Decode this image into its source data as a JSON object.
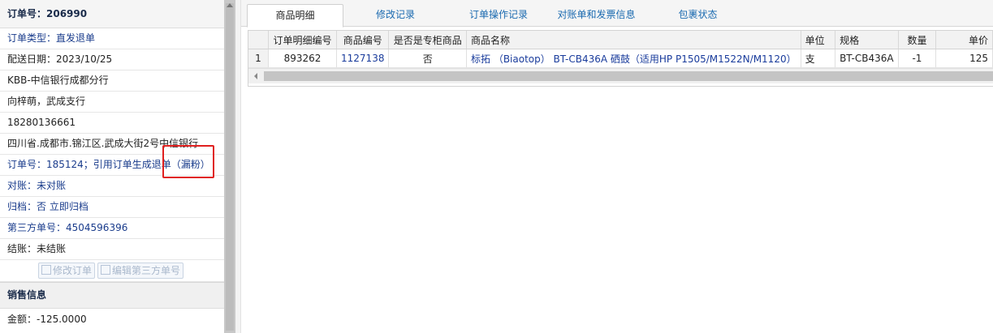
{
  "order": {
    "header": "订单号：206990",
    "rows": [
      {
        "text": "订单类型：直发退单",
        "style": "blue"
      },
      {
        "text": "配送日期：2023/10/25",
        "style": "dark"
      },
      {
        "text": "KBB-中信银行成都分行",
        "style": "dark"
      },
      {
        "text": "向梓萌，武成支行",
        "style": "dark"
      },
      {
        "text": "18280136661",
        "style": "dark"
      },
      {
        "text": "四川省.成都市.锦江区.武成大街2号中信银行",
        "style": "dark"
      },
      {
        "text": "订单号：185124；引用订单生成退单（漏粉）",
        "style": "blue"
      },
      {
        "text": "对账：未对账",
        "style": "blue"
      },
      {
        "text": "归档：否 立即归档",
        "style": "blue"
      },
      {
        "text": "第三方单号：4504596396",
        "style": "blue"
      },
      {
        "text": "结账：未结账",
        "style": "dark"
      }
    ],
    "buttons": {
      "edit_order": "修改订单",
      "edit_third_party": "编辑第三方单号"
    }
  },
  "sales": {
    "section_title": "销售信息",
    "amount": "金额：-125.0000"
  },
  "tabs": [
    {
      "label": "商品明细",
      "active": true
    },
    {
      "label": "修改记录",
      "active": false
    },
    {
      "label": "订单操作记录",
      "active": false
    },
    {
      "label": "对账单和发票信息",
      "active": false
    },
    {
      "label": "包裹状态",
      "active": false
    }
  ],
  "table": {
    "columns": [
      "",
      "订单明细编号",
      "商品编号",
      "是否是专柜商品",
      "商品名称",
      "单位",
      "规格",
      "数量",
      "单价"
    ],
    "rows": [
      {
        "rownum": "1",
        "detail_id": "893262",
        "product_id": "1127138",
        "is_counter": "否",
        "name": "标拓 （Biaotop） BT-CB436A 硒鼓（适用HP P1505/M1522N/M1120）",
        "unit": "支",
        "spec": "BT-CB436A",
        "qty": "-1",
        "price": "125"
      }
    ]
  },
  "colors": {
    "highlight_box": "#e0201f",
    "link_blue": "#1a3c9c",
    "tab_blue": "#1a6ab0"
  }
}
